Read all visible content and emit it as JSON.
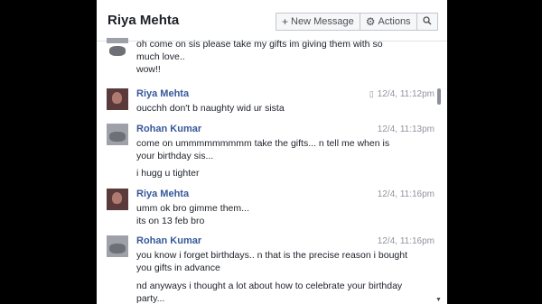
{
  "header": {
    "title": "Riya Mehta",
    "new_message": "New Message",
    "actions": "Actions"
  },
  "messages": {
    "m0": {
      "lines": [
        "oh come on sis please take my gifts im giving them with so",
        "much love.."
      ]
    },
    "m0b": {
      "lines": [
        "wow!!"
      ]
    },
    "m1": {
      "name": "Riya Mehta",
      "time": "12/4, 11:12pm",
      "lines": [
        "oucchh don't b naughty wid ur sista"
      ]
    },
    "m2": {
      "name": "Rohan Kumar",
      "time": "12/4, 11:13pm",
      "lines": [
        "come on ummmmmmmmm take the gifts... n tell me when is",
        "your birthday sis..."
      ]
    },
    "m2b": {
      "lines": [
        "i hugg u tighter"
      ]
    },
    "m3": {
      "name": "Riya Mehta",
      "time": "12/4, 11:16pm",
      "lines": [
        "umm ok bro gimme them...",
        "its on 13 feb bro"
      ]
    },
    "m4": {
      "name": "Rohan Kumar",
      "time": "12/4, 11:16pm",
      "lines": [
        "you know i forget birthdays.. n that is the precise reason i bought",
        "you gifts in advance"
      ]
    },
    "m4b": {
      "lines": [
        "nd anyways i thought a lot about how to celebrate your birthday",
        "party..."
      ]
    }
  },
  "icons": {
    "new_message": "plus-icon",
    "actions": "gear-icon",
    "search": "search-icon",
    "phone": "phone-icon"
  }
}
